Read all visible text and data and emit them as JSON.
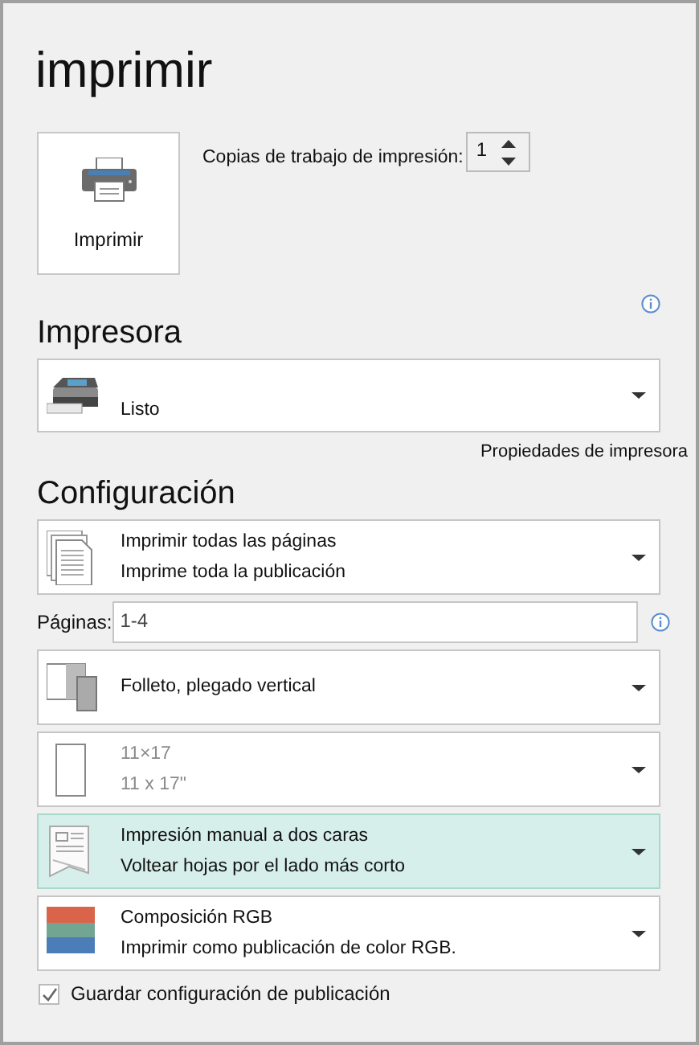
{
  "title": "imprimir",
  "print_button": {
    "label": "Imprimir"
  },
  "copies": {
    "label": "Copias de trabajo de impresión:",
    "value": "1"
  },
  "printer": {
    "heading": "Impresora",
    "status": "Listo",
    "properties_link": "Propiedades de impresora"
  },
  "settings": {
    "heading": "Configuración",
    "dropdowns": [
      {
        "kind": "pages",
        "line1": "Imprimir todas las páginas",
        "line2": "Imprime toda la publicación",
        "selected": false,
        "disabled": false
      },
      {
        "kind": "pages_field",
        "label": "Páginas:",
        "value": "1-4"
      },
      {
        "kind": "booklet",
        "line1": "Folleto, plegado vertical",
        "selected": false,
        "disabled": false
      },
      {
        "kind": "paper",
        "line1": "11×17",
        "line2": "11 x 17\"",
        "selected": false,
        "disabled": true
      },
      {
        "kind": "duplex",
        "line1": "Impresión manual a dos caras",
        "line2": "Voltear hojas por el lado más corto",
        "selected": true,
        "disabled": false
      },
      {
        "kind": "color",
        "line1": "Composición RGB",
        "line2": "Imprimir como publicación de color RGB.",
        "selected": false,
        "disabled": false
      }
    ]
  },
  "save_settings": {
    "label": "Guardar configuración de publicación",
    "checked": true
  }
}
